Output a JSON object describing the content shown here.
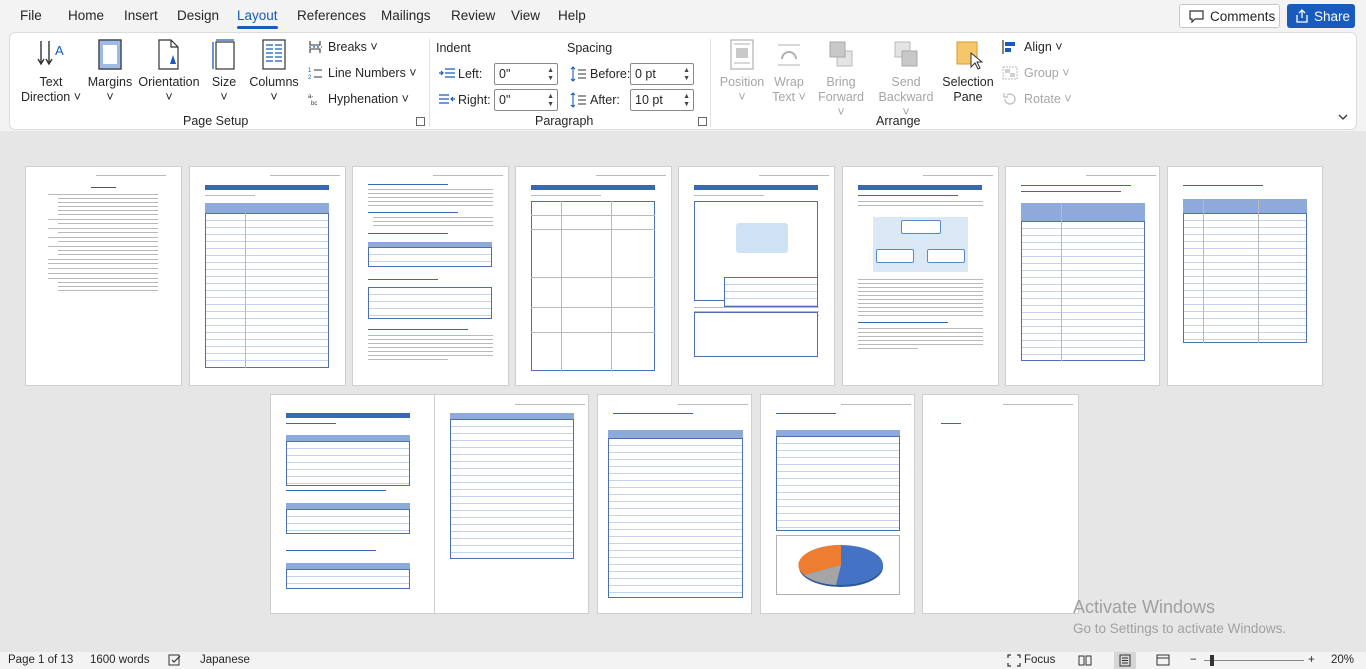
{
  "menu": {
    "tabs": [
      "File",
      "Home",
      "Insert",
      "Design",
      "Layout",
      "References",
      "Mailings",
      "Review",
      "View",
      "Help"
    ],
    "active_tab": "Layout",
    "comments_label": "Comments",
    "share_label": "Share"
  },
  "ribbon": {
    "page_setup": {
      "label": "Page Setup",
      "text_direction": [
        "Text",
        "Direction ˅"
      ],
      "margins": [
        "Margins",
        "˅"
      ],
      "orientation": [
        "Orientation",
        "˅"
      ],
      "size": [
        "Size",
        "˅"
      ],
      "columns": [
        "Columns",
        "˅"
      ],
      "breaks": "Breaks ˅",
      "line_numbers": "Line Numbers ˅",
      "hyphenation": "Hyphenation ˅"
    },
    "paragraph": {
      "label": "Paragraph",
      "indent_heading": "Indent",
      "spacing_heading": "Spacing",
      "left_label": "Left:",
      "left_value": "0\"",
      "right_label": "Right:",
      "right_value": "0\"",
      "before_label": "Before:",
      "before_value": "0 pt",
      "after_label": "After:",
      "after_value": "10 pt"
    },
    "arrange": {
      "label": "Arrange",
      "position": [
        "Position",
        "˅"
      ],
      "wrap_text": [
        "Wrap",
        "Text ˅"
      ],
      "bring_forward": [
        "Bring",
        "Forward ˅"
      ],
      "send_backward": [
        "Send",
        "Backward ˅"
      ],
      "selection_pane": [
        "Selection",
        "Pane"
      ],
      "align": "Align ˅",
      "group": "Group ˅",
      "rotate": "Rotate ˅"
    }
  },
  "watermark": {
    "line1": "Activate Windows",
    "line2": "Go to Settings to activate Windows."
  },
  "status": {
    "page": "Page 1 of 13",
    "words": "1600 words",
    "language": "Japanese",
    "focus": "Focus",
    "zoom": "20%"
  },
  "colors": {
    "accent": "#185abd",
    "table_blue": "#4472c4"
  }
}
